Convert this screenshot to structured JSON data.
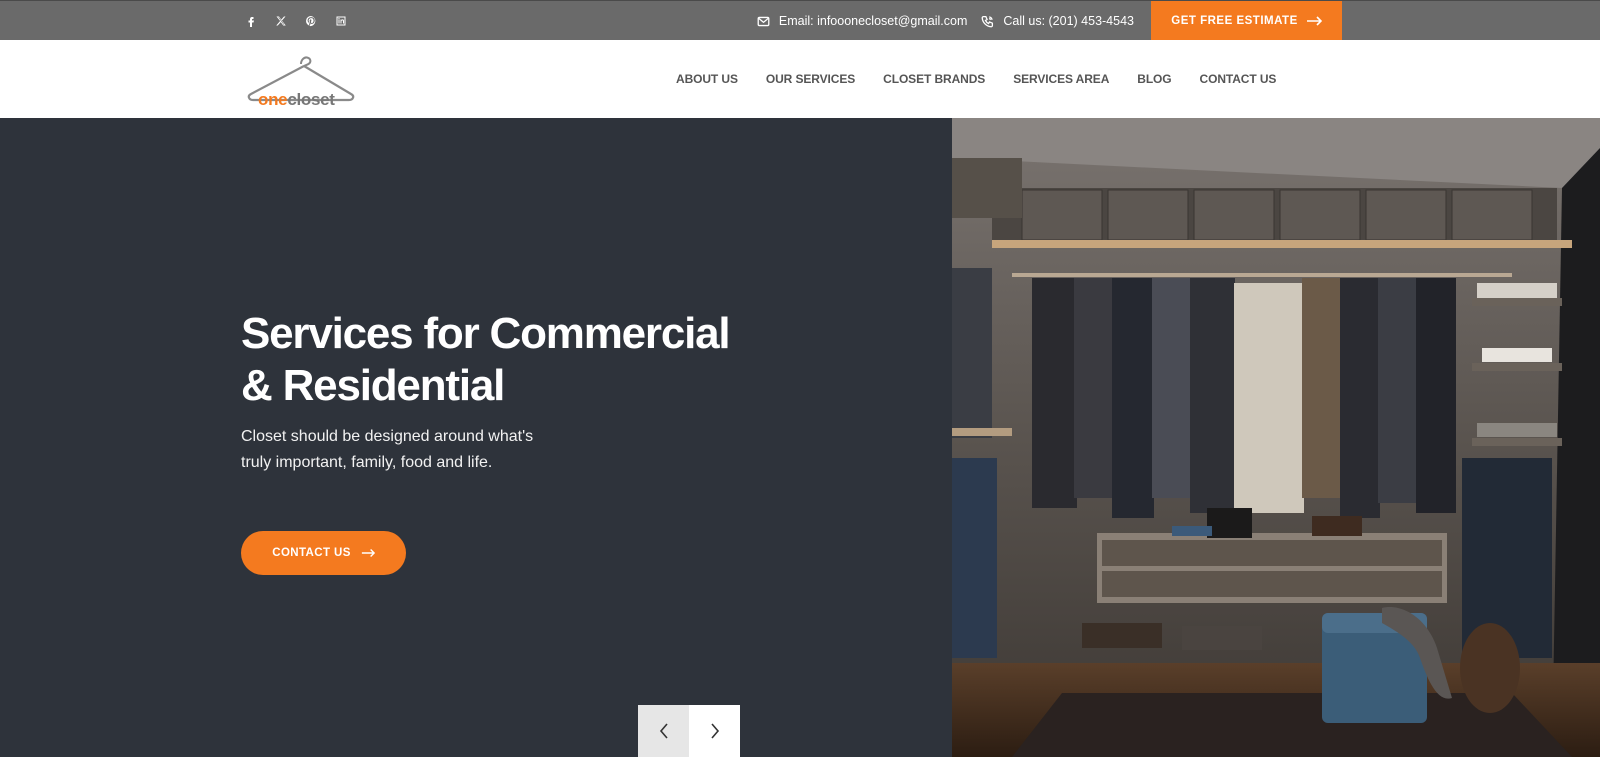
{
  "topbar": {
    "social": [
      {
        "name": "facebook-icon"
      },
      {
        "name": "x-icon"
      },
      {
        "name": "pinterest-icon"
      },
      {
        "name": "linkedin-icon"
      }
    ],
    "email_text": "Email: infooonecloset@gmail.com",
    "phone_text": "Call us: (201) 453-4543",
    "estimate_label": "GET FREE ESTIMATE"
  },
  "logo": {
    "one": "one",
    "closet": "closet"
  },
  "nav": [
    "ABOUT US",
    "OUR SERVICES",
    "CLOSET BRANDS",
    "SERVICES AREA",
    "BLOG",
    "CONTACT US"
  ],
  "hero": {
    "title_line1": "Services for Commercial",
    "title_line2": "& Residential",
    "subtitle_line1": "Closet should be designed around what's",
    "subtitle_line2": "truly important, family, food and life.",
    "cta_label": "CONTACT US"
  },
  "colors": {
    "accent": "#f47a1f",
    "topbar": "#6a6a6a",
    "hero_bg": "#2e333b"
  }
}
